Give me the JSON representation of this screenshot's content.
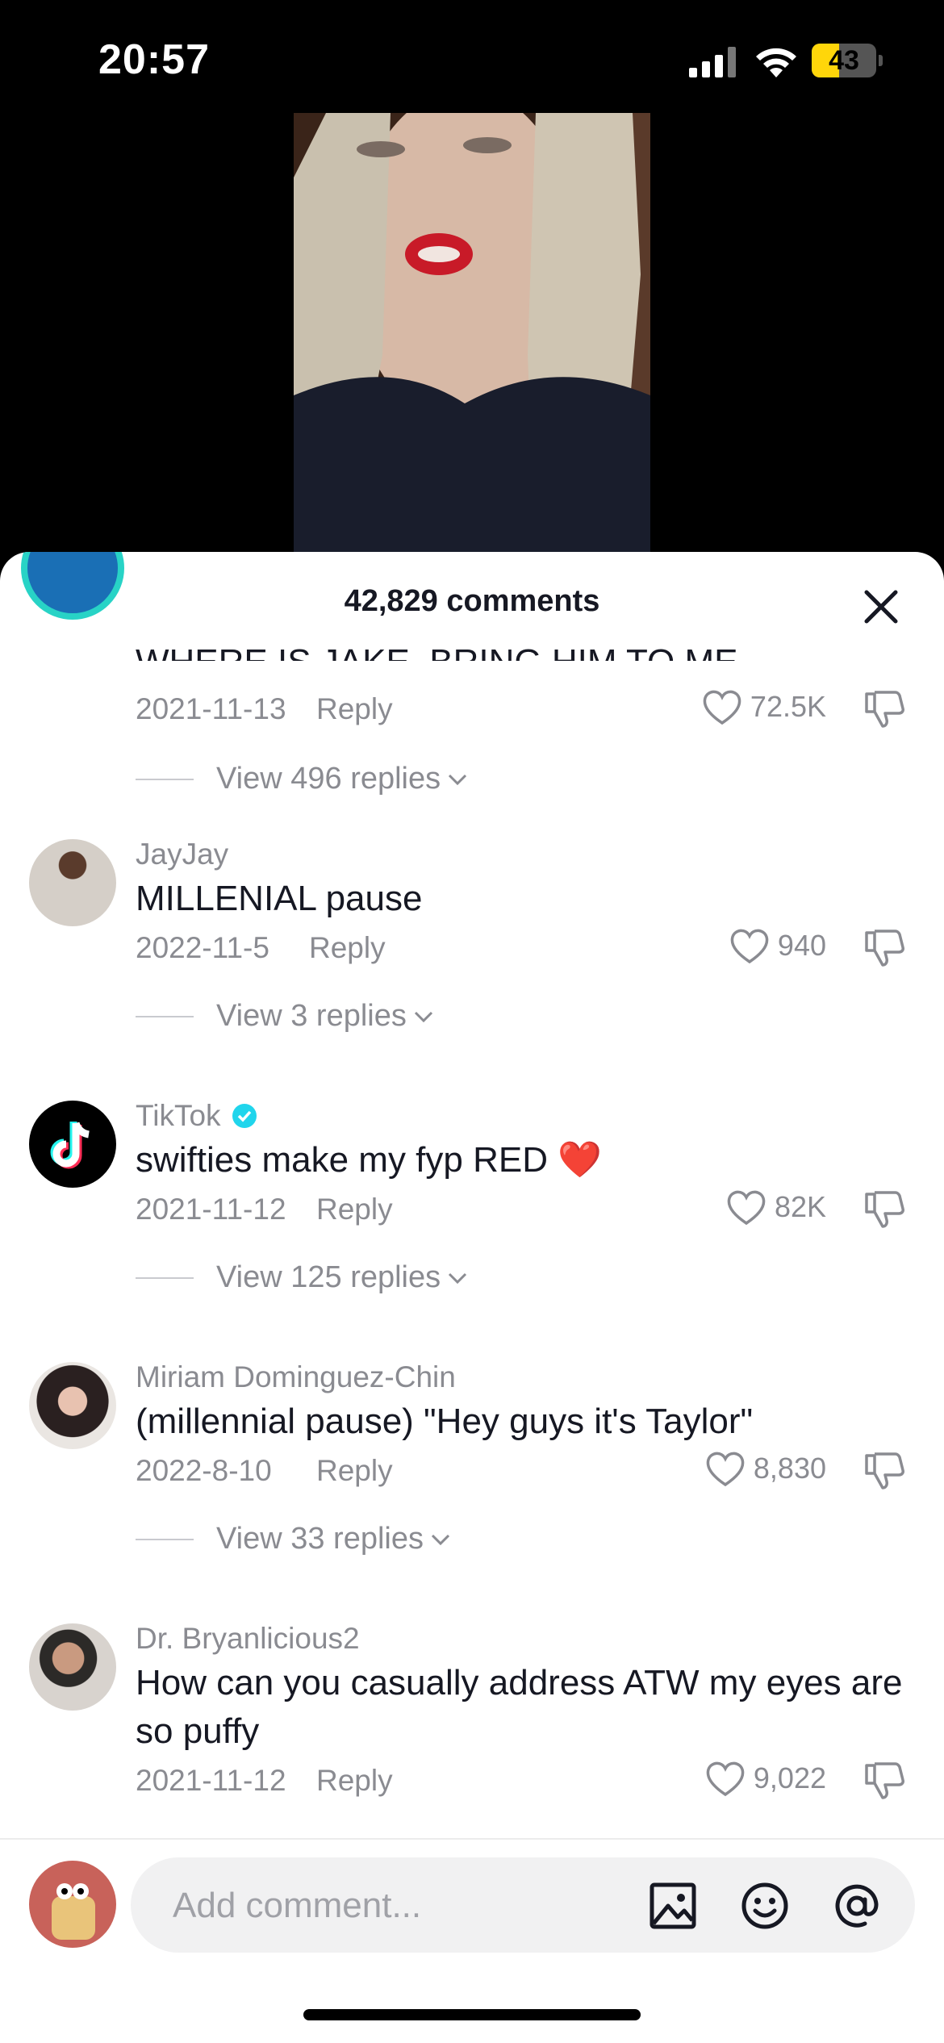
{
  "status_bar": {
    "time": "20:57",
    "battery": "43",
    "battery_level": 0.43
  },
  "sheet": {
    "comment_count": "42,829 comments",
    "close_icon": "close-icon"
  },
  "comments": [
    {
      "text": "WHERE IS JAKE. BRING HIM TO ME",
      "date": "2021-11-13",
      "reply": "Reply",
      "likes": "72.5K",
      "view_replies": "View 496 replies"
    },
    {
      "username": "JayJay",
      "text": "MILLENIAL pause",
      "date": "2022-11-5",
      "reply": "Reply",
      "likes": "940",
      "view_replies": "View 3 replies"
    },
    {
      "username": "TikTok",
      "verified": true,
      "text": "swifties make my fyp RED ❤️",
      "date": "2021-11-12",
      "reply": "Reply",
      "likes": "82K",
      "view_replies": "View 125 replies"
    },
    {
      "username": "Miriam Dominguez-Chin",
      "text": "(millennial pause) \"Hey guys it's Taylor\"",
      "date": "2022-8-10",
      "reply": "Reply",
      "likes": "8,830",
      "view_replies": "View 33 replies"
    },
    {
      "username": "Dr. Bryanlicious2",
      "text": "How can you casually address ATW my eyes are so puffy",
      "date": "2021-11-12",
      "reply": "Reply",
      "likes": "9,022"
    }
  ],
  "composer": {
    "placeholder": "Add comment...",
    "icons": [
      "image-icon",
      "emoji-icon",
      "mention-icon"
    ]
  },
  "colors": {
    "verified": "#20d5ec",
    "muted": "#8a8b91",
    "text": "#161823"
  }
}
